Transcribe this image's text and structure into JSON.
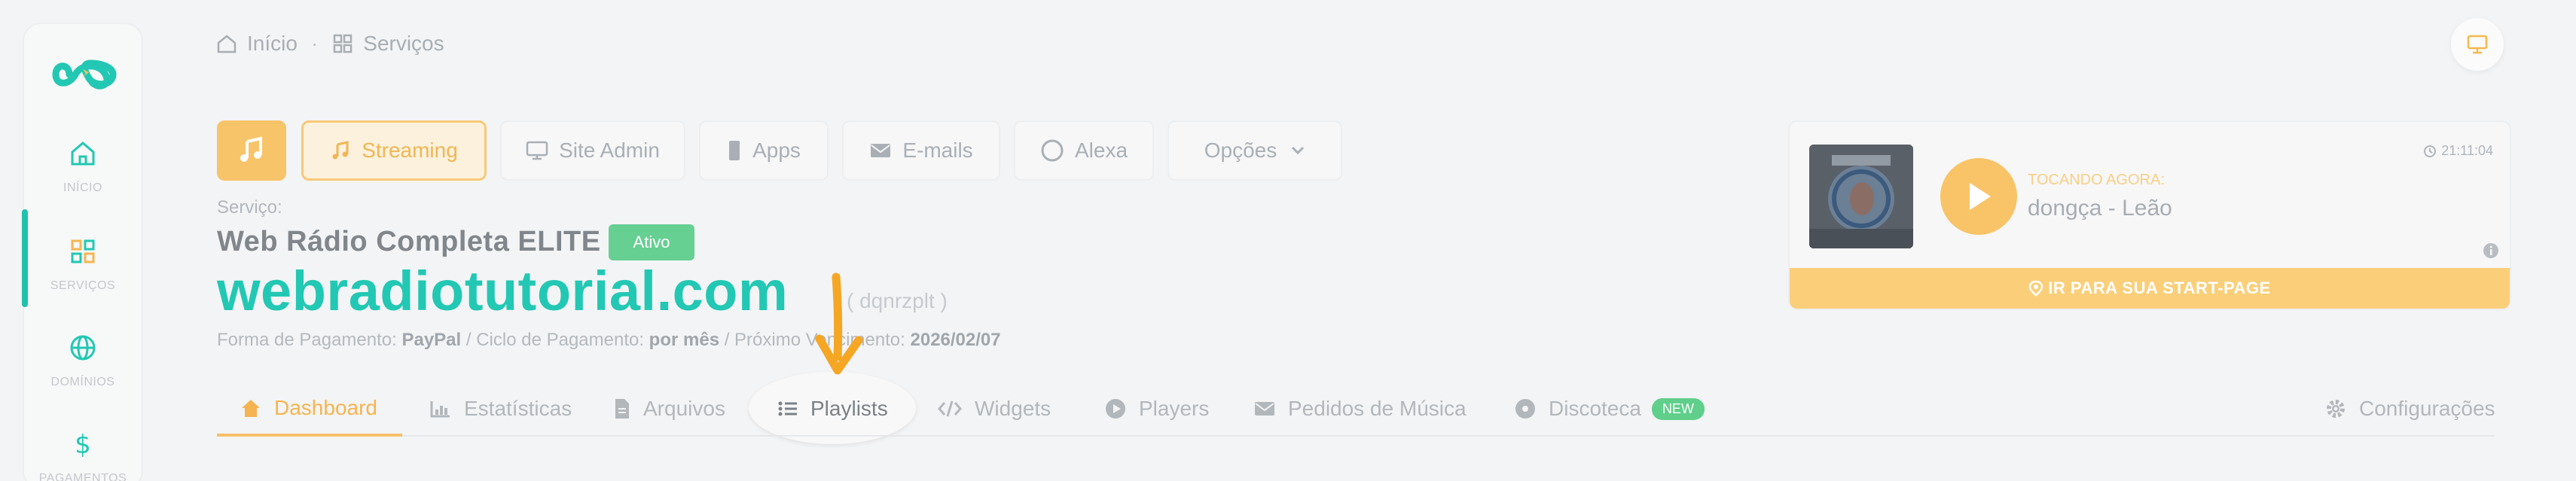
{
  "sidebar": {
    "items": [
      {
        "label": "INÍCIO",
        "icon": "home-icon"
      },
      {
        "label": "SERVIÇOS",
        "icon": "grid-icon"
      },
      {
        "label": "DOMÍNIOS",
        "icon": "globe-icon"
      },
      {
        "label": "PAGAMENTOS",
        "icon": "dollar-icon"
      }
    ],
    "active": "SERVIÇOS"
  },
  "breadcrumb": {
    "home": "Início",
    "sep": "·",
    "current": "Serviços"
  },
  "service_buttons": {
    "streaming": "Streaming",
    "site_admin": "Site Admin",
    "apps": "Apps",
    "emails": "E-mails",
    "alexa": "Alexa",
    "options": "Opções"
  },
  "service": {
    "label": "Serviço:",
    "name": "Web Rádio Completa ELITE",
    "status": "Ativo",
    "domain": "webradiotutorial.com",
    "code": "( dqnrzplt )",
    "payment_prefix": "Forma de Pagamento: ",
    "payment_method": "PayPal",
    "cycle_prefix": " / Ciclo de Pagamento: ",
    "cycle": "por mês",
    "due_prefix": " / Próximo Vencimento: ",
    "due": "2026/02/07"
  },
  "tabs": [
    {
      "label": "Dashboard",
      "icon": "home-icon",
      "active": true
    },
    {
      "label": "Estatísticas",
      "icon": "chart-icon"
    },
    {
      "label": "Arquivos",
      "icon": "file-icon"
    },
    {
      "label": "Playlists",
      "icon": "list-icon"
    },
    {
      "label": "Widgets",
      "icon": "code-icon"
    },
    {
      "label": "Players",
      "icon": "play-icon"
    },
    {
      "label": "Pedidos de Música",
      "icon": "envelope-icon"
    },
    {
      "label": "Discoteca",
      "icon": "disc-icon",
      "badge": "NEW"
    },
    {
      "label": "Configurações",
      "icon": "gear-icon"
    }
  ],
  "player": {
    "time": "21:11:04",
    "now_playing_label": "TOCANDO AGORA:",
    "track": "dongça - Leão",
    "start_page_button": "IR PARA SUA START-PAGE"
  },
  "colors": {
    "accent": "#f6c06a",
    "teal": "#22c8b3",
    "status_green": "#66cf92"
  }
}
